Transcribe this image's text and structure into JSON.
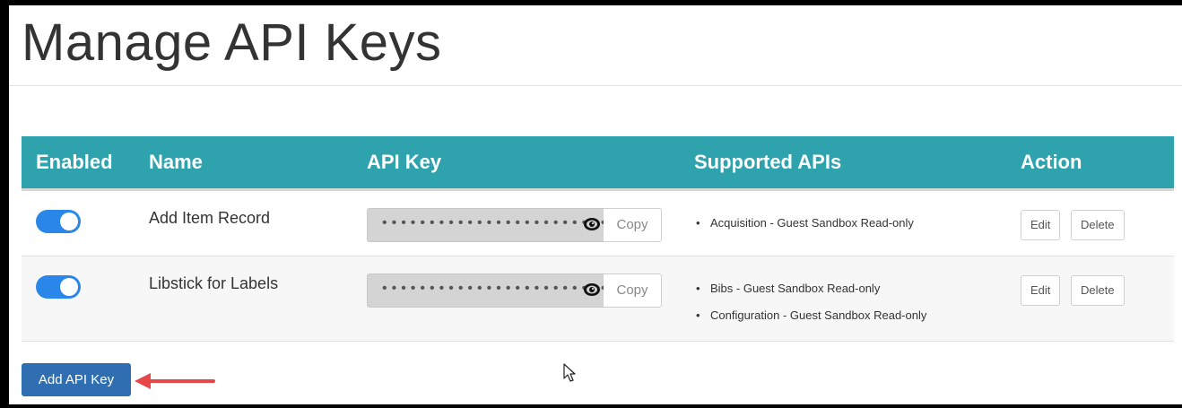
{
  "page": {
    "title": "Manage API Keys"
  },
  "table": {
    "headers": {
      "enabled": "Enabled",
      "name": "Name",
      "api_key": "API Key",
      "supported_apis": "Supported APIs",
      "action": "Action"
    },
    "rows": [
      {
        "enabled": true,
        "name": "Add Item Record",
        "api_key_masked": "•••••••••••••••••••••••••",
        "copy_label": "Copy",
        "supported_apis": [
          "Acquisition - Guest Sandbox Read-only"
        ],
        "edit_label": "Edit",
        "delete_label": "Delete"
      },
      {
        "enabled": true,
        "name": "Libstick for Labels",
        "api_key_masked": "•••••••••••••••••••••••••",
        "copy_label": "Copy",
        "supported_apis": [
          "Bibs - Guest Sandbox Read-only",
          "Configuration - Guest Sandbox Read-only"
        ],
        "edit_label": "Edit",
        "delete_label": "Delete"
      }
    ]
  },
  "add_button_label": "Add API Key",
  "colors": {
    "header_bg": "#2fa3ad",
    "toggle_on": "#2a86e8",
    "primary_button": "#2f6fb1",
    "annotation_arrow": "#e8474a"
  },
  "icons": {
    "reveal": "eye-icon",
    "annotation": "red-arrow-icon",
    "pointer": "mouse-cursor-icon"
  }
}
